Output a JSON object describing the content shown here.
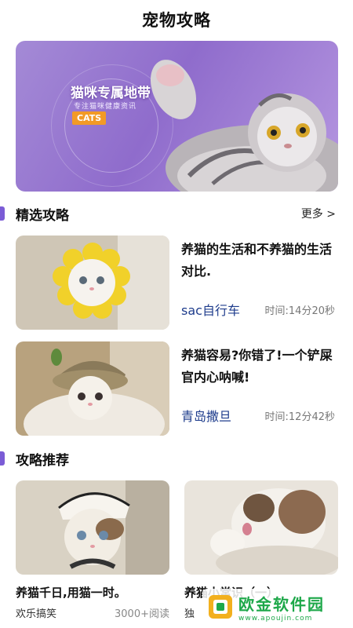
{
  "header": {
    "title": "宠物攻略"
  },
  "banner": {
    "title": "猫咪专属地带",
    "subtitle": "专注猫咪健康资讯",
    "tag": "CATS"
  },
  "featured": {
    "title": "精选攻略",
    "more_label": "更多 >",
    "items": [
      {
        "title": "养猫的生活和不养猫的生活对比.",
        "author": "sac自行车",
        "time": "时间:14分20秒"
      },
      {
        "title": "养猫容易?你错了!一个铲屎官内心呐喊!",
        "author": "青岛撒旦",
        "time": "时间:12分42秒"
      }
    ]
  },
  "recommend": {
    "title": "攻略推荐",
    "items": [
      {
        "title": "养猫千日,用猫一时。",
        "author": "欢乐搞笑",
        "reads": "3000+阅读"
      },
      {
        "title": "养猫小常识（一）",
        "author": "独",
        "reads": ""
      }
    ]
  },
  "watermark": {
    "name": "欧金软件园",
    "url": "www.apoujin.com"
  },
  "colors": {
    "accent": "#7b5cd6",
    "author": "#1e3c8c",
    "banner": "#9a7bd4",
    "watermark": "#1ea84a"
  }
}
